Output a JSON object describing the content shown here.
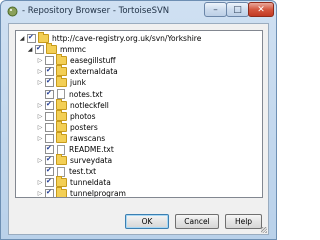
{
  "window": {
    "title": "- Repository Browser - TortoiseSVN",
    "min_glyph": "–",
    "max_glyph": "□",
    "close_glyph": "✕"
  },
  "tree": {
    "items": [
      {
        "label": "http://cave-registry.org.uk/svn/Yorkshire",
        "type": "folder",
        "checked": true,
        "expanded": true
      },
      {
        "label": "mmmc",
        "type": "folder",
        "checked": true,
        "expanded": true
      },
      {
        "label": "easegillstuff",
        "type": "folder",
        "checked": false,
        "expanded": false
      },
      {
        "label": "externaldata",
        "type": "folder",
        "checked": true,
        "expanded": false
      },
      {
        "label": "junk",
        "type": "folder",
        "checked": true,
        "expanded": false
      },
      {
        "label": "notes.txt",
        "type": "file",
        "checked": true
      },
      {
        "label": "notleckfell",
        "type": "folder",
        "checked": true,
        "expanded": false
      },
      {
        "label": "photos",
        "type": "folder",
        "checked": false,
        "expanded": false
      },
      {
        "label": "posters",
        "type": "folder",
        "checked": false,
        "expanded": false
      },
      {
        "label": "rawscans",
        "type": "folder",
        "checked": false,
        "expanded": false
      },
      {
        "label": "README.txt",
        "type": "file",
        "checked": true
      },
      {
        "label": "surveydata",
        "type": "folder",
        "checked": true,
        "expanded": false
      },
      {
        "label": "test.txt",
        "type": "file",
        "checked": true
      },
      {
        "label": "tunneldata",
        "type": "folder",
        "checked": true,
        "expanded": false
      },
      {
        "label": "tunnelprogram",
        "type": "folder",
        "checked": true,
        "expanded": false
      }
    ]
  },
  "buttons": {
    "ok": "OK",
    "cancel": "Cancel",
    "help": "Help"
  }
}
